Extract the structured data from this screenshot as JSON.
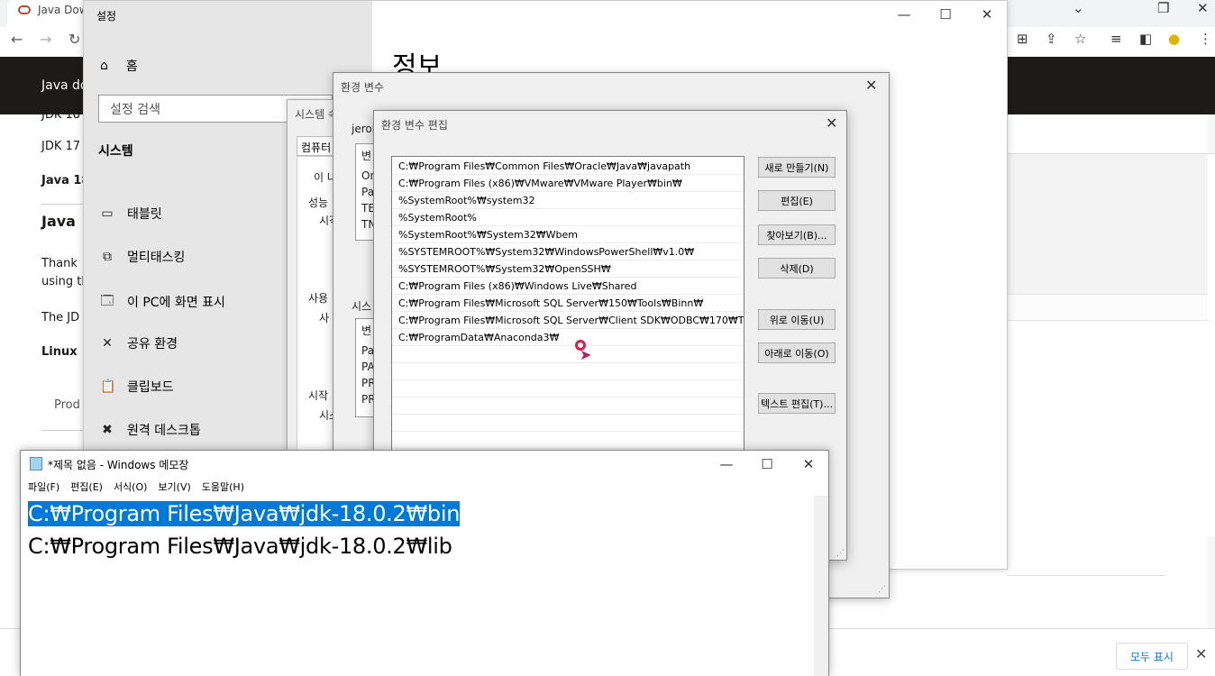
{
  "browser": {
    "tab_title": "Java Dow",
    "oracle_nav_label": "Java do",
    "page_lines": [
      "JDK 18",
      "JDK 17",
      "Java 18",
      "Java",
      "Thank",
      "using th",
      "The JD",
      "Linux",
      "Prod"
    ],
    "show_all": "모두 표시",
    "close": "✕"
  },
  "settings": {
    "title": "설정",
    "home": "홈",
    "search_placeholder": "설정 검색",
    "section": "시스템",
    "items": [
      {
        "icon": "tablet-icon",
        "glyph": "▭",
        "label": "태블릿"
      },
      {
        "icon": "multitasking-icon",
        "glyph": "⧉",
        "label": "멀티태스킹"
      },
      {
        "icon": "project-icon",
        "glyph": "🗔",
        "label": "이 PC에 화면 표시"
      },
      {
        "icon": "share-icon",
        "glyph": "✕",
        "label": "공유 환경"
      },
      {
        "icon": "clipboard-icon",
        "glyph": "📋",
        "label": "클립보드"
      },
      {
        "icon": "remote-desktop-icon",
        "glyph": "✖",
        "label": "원격 데스크톱"
      }
    ],
    "page_title": "정보"
  },
  "sysprops": {
    "title": "시스템 속",
    "tab": "컴퓨터 이",
    "line_1": "이 나",
    "group_1": "성능",
    "group_1_text": "시각",
    "group_2": "사용",
    "group_2_text": "사",
    "group_3": "시작",
    "group_3_text": "시스"
  },
  "envvars": {
    "title": "환경 변수",
    "user_label": "jerok",
    "user_header": "변",
    "user_rows": [
      "On",
      "Pa",
      "TE",
      "TN"
    ],
    "system_label": "시스",
    "system_header": "변",
    "system_rows": [
      "Pa",
      "PA",
      "PR",
      "PR"
    ]
  },
  "edit_dialog": {
    "title": "환경 변수 편집",
    "paths": [
      "C:₩Program Files₩Common Files₩Oracle₩Java₩javapath",
      "C:₩Program Files (x86)₩VMware₩VMware Player₩bin₩",
      "%SystemRoot%₩system32",
      "%SystemRoot%",
      "%SystemRoot%₩System32₩Wbem",
      "%SYSTEMROOT%₩System32₩WindowsPowerShell₩v1.0₩",
      "%SYSTEMROOT%₩System32₩OpenSSH₩",
      "C:₩Program Files (x86)₩Windows Live₩Shared",
      "C:₩Program Files₩Microsoft SQL Server₩150₩Tools₩Binn₩",
      "C:₩Program Files₩Microsoft SQL Server₩Client SDK₩ODBC₩170₩T...",
      "C:₩ProgramData₩Anaconda3₩"
    ],
    "buttons": {
      "new": "새로 만들기(N)",
      "edit": "편집(E)",
      "browse": "찾아보기(B)...",
      "delete": "삭제(D)",
      "move_up": "위로 이동(U)",
      "move_down": "아래로 이동(O)",
      "edit_text": "텍스트 편집(T)..."
    }
  },
  "notepad": {
    "title": "*제목 없음 - Windows 메모장",
    "menu": [
      "파일(F)",
      "편집(E)",
      "서식(O)",
      "보기(V)",
      "도움말(H)"
    ],
    "lines": [
      "C:₩Program Files₩Java₩jdk-18.0.2₩bin",
      "C:₩Program Files₩Java₩jdk-18.0.2₩lib"
    ]
  }
}
